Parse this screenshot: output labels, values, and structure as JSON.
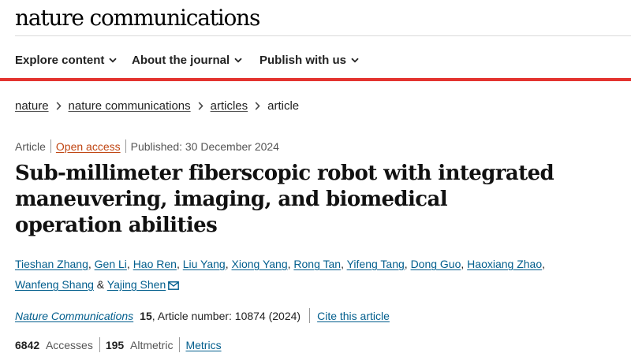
{
  "header": {
    "logo": "nature communications"
  },
  "nav": {
    "items": [
      {
        "label": "Explore content"
      },
      {
        "label": "About the journal"
      },
      {
        "label": "Publish with us"
      }
    ]
  },
  "breadcrumb": {
    "items": [
      "nature",
      "nature communications",
      "articles"
    ],
    "current": "article"
  },
  "article": {
    "type": "Article",
    "access": "Open access",
    "published": "Published: 30 December 2024",
    "title": "Sub-millimeter fiberscopic robot with integrated maneuvering, imaging, and biomedical operation abilities",
    "authors": [
      "Tieshan Zhang",
      "Gen Li",
      "Hao Ren",
      "Liu Yang",
      "Xiong Yang",
      "Rong Tan",
      "Yifeng Tang",
      "Dong Guo",
      "Haoxiang Zhao",
      "Wanfeng Shang",
      "Yajing Shen"
    ],
    "author_sep": ",",
    "author_and": "&",
    "journal": "Nature Communications",
    "volume": "15",
    "article_number": ", Article number: 10874 (2024)",
    "cite_label": "Cite this article",
    "accesses_count": "6842",
    "accesses_label": "Accesses",
    "altmetric_count": "195",
    "altmetric_label": "Altmetric",
    "metrics_label": "Metrics"
  },
  "colors": {
    "accent_red": "#e3342f",
    "link_blue": "#025e8d",
    "open_access_orange": "#c04613"
  },
  "icons": {
    "nav_dropdown": "chevron-down-icon",
    "breadcrumb": "chevron-right-icon",
    "corresponding_author": "mail-icon"
  }
}
